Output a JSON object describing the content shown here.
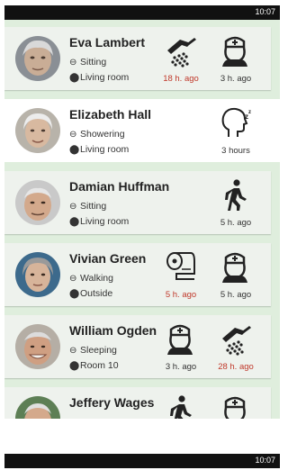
{
  "status_bar": {
    "time": "10:07"
  },
  "residents": [
    {
      "name": "Eva Lambert",
      "activity": "Sitting",
      "location": "Living room",
      "alerts": [
        {
          "icon": "shower-icon",
          "time": "18 h. ago",
          "status": "overdue"
        },
        {
          "icon": "nurse-icon",
          "time": "3 h. ago",
          "status": "normal"
        }
      ]
    },
    {
      "name": "Elizabeth Hall",
      "activity": "Showering",
      "location": "Living room",
      "alerts": [
        {
          "icon": "sleep-head-icon",
          "time": "3 hours",
          "status": "normal"
        }
      ]
    },
    {
      "name": "Damian Huffman",
      "activity": "Sitting",
      "location": "Living room",
      "alerts": [
        {
          "icon": "walking-icon",
          "time": "5 h. ago",
          "status": "normal"
        }
      ]
    },
    {
      "name": "Vivian Green",
      "activity": "Walking",
      "location": "Outside",
      "alerts": [
        {
          "icon": "toilet-paper-icon",
          "time": "5 h. ago",
          "status": "overdue"
        },
        {
          "icon": "nurse-icon",
          "time": "5 h. ago",
          "status": "normal"
        }
      ]
    },
    {
      "name": "William Ogden",
      "activity": "Sleeping",
      "location": "Room 10",
      "alerts": [
        {
          "icon": "nurse-icon",
          "time": "3 h. ago",
          "status": "normal"
        },
        {
          "icon": "shower-icon",
          "time": "28 h. ago",
          "status": "overdue"
        }
      ]
    },
    {
      "name": "Jeffery Wages",
      "activity": "",
      "location": "",
      "alerts": [
        {
          "icon": "walking-icon",
          "time": "",
          "status": "normal"
        },
        {
          "icon": "nurse-icon",
          "time": "",
          "status": "normal"
        }
      ]
    }
  ],
  "colors": {
    "overdue": "#c0392b",
    "list_background": "#dfeedd",
    "card": "#eef2ed",
    "selected_card": "#ffffff"
  }
}
